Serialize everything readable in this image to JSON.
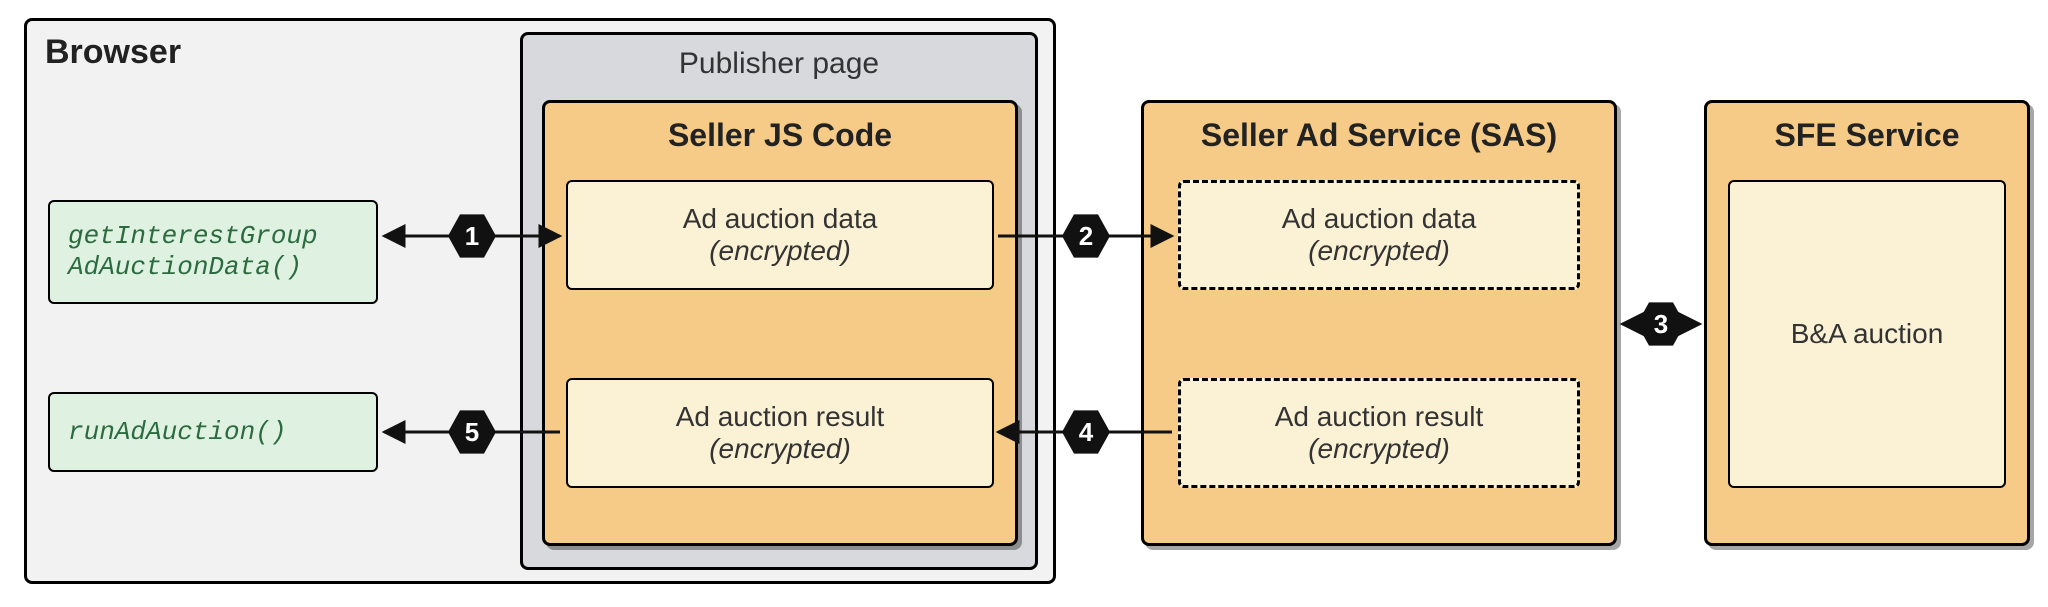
{
  "browser": {
    "title": "Browser"
  },
  "publisher": {
    "title": "Publisher page"
  },
  "seller_js": {
    "title": "Seller JS Code",
    "data_box": {
      "line1": "Ad auction data",
      "line2": "(encrypted)"
    },
    "result_box": {
      "line1": "Ad auction result",
      "line2": "(encrypted)"
    }
  },
  "sas": {
    "title": "Seller Ad Service (SAS)",
    "data_box": {
      "line1": "Ad auction data",
      "line2": "(encrypted)"
    },
    "result_box": {
      "line1": "Ad auction result",
      "line2": "(encrypted)"
    }
  },
  "sfe": {
    "title": "SFE Service",
    "auction_box": "B&A auction"
  },
  "api": {
    "get": "getInterestGroup\nAdAuctionData()",
    "run": "runAdAuction()"
  },
  "steps": {
    "s1": "1",
    "s2": "2",
    "s3": "3",
    "s4": "4",
    "s5": "5"
  }
}
